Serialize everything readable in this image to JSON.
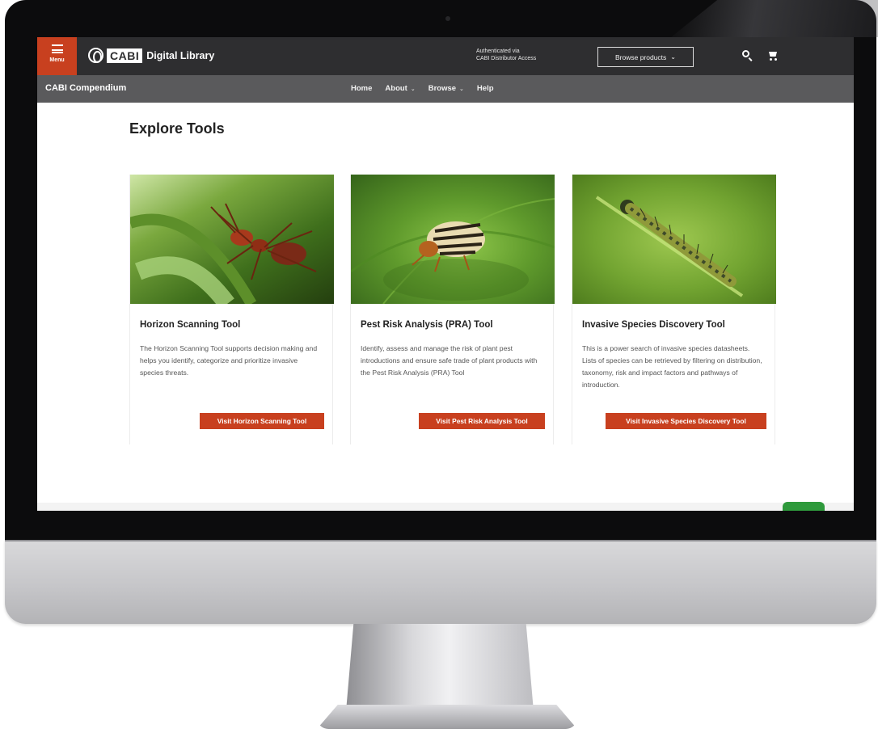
{
  "topbar": {
    "menu_label": "Menu",
    "logo_box": "CABI",
    "logo_text": "Digital Library",
    "auth_line1": "Authenticated via",
    "auth_line2": "CABI Distributor Access",
    "browse_label": "Browse products",
    "brand_color": "#c8401f"
  },
  "subbar": {
    "title": "CABI Compendium",
    "nav": [
      {
        "label": "Home"
      },
      {
        "label": "About"
      },
      {
        "label": "Browse"
      },
      {
        "label": "Help"
      }
    ]
  },
  "main": {
    "title": "Explore Tools",
    "cards": [
      {
        "title": "Horizon Scanning Tool",
        "description": "The Horizon Scanning Tool supports decision making and helps you identify, categorize and prioritize invasive species threats.",
        "button": "Visit Horizon Scanning Tool"
      },
      {
        "title": "Pest Risk Analysis (PRA) Tool",
        "description": "Identify, assess and manage the risk of plant pest introductions and ensure safe trade of plant products with the Pest Risk Analysis (PRA) Tool",
        "button": "Visit Pest Risk Analysis Tool"
      },
      {
        "title": "Invasive Species Discovery Tool",
        "description": "This is a power search of invasive species datasheets. Lists of species can be retrieved by filtering on distribution, taxonomy, risk and impact factors and pathways of introduction.",
        "button": "Visit Invasive Species Discovery Tool"
      }
    ]
  }
}
